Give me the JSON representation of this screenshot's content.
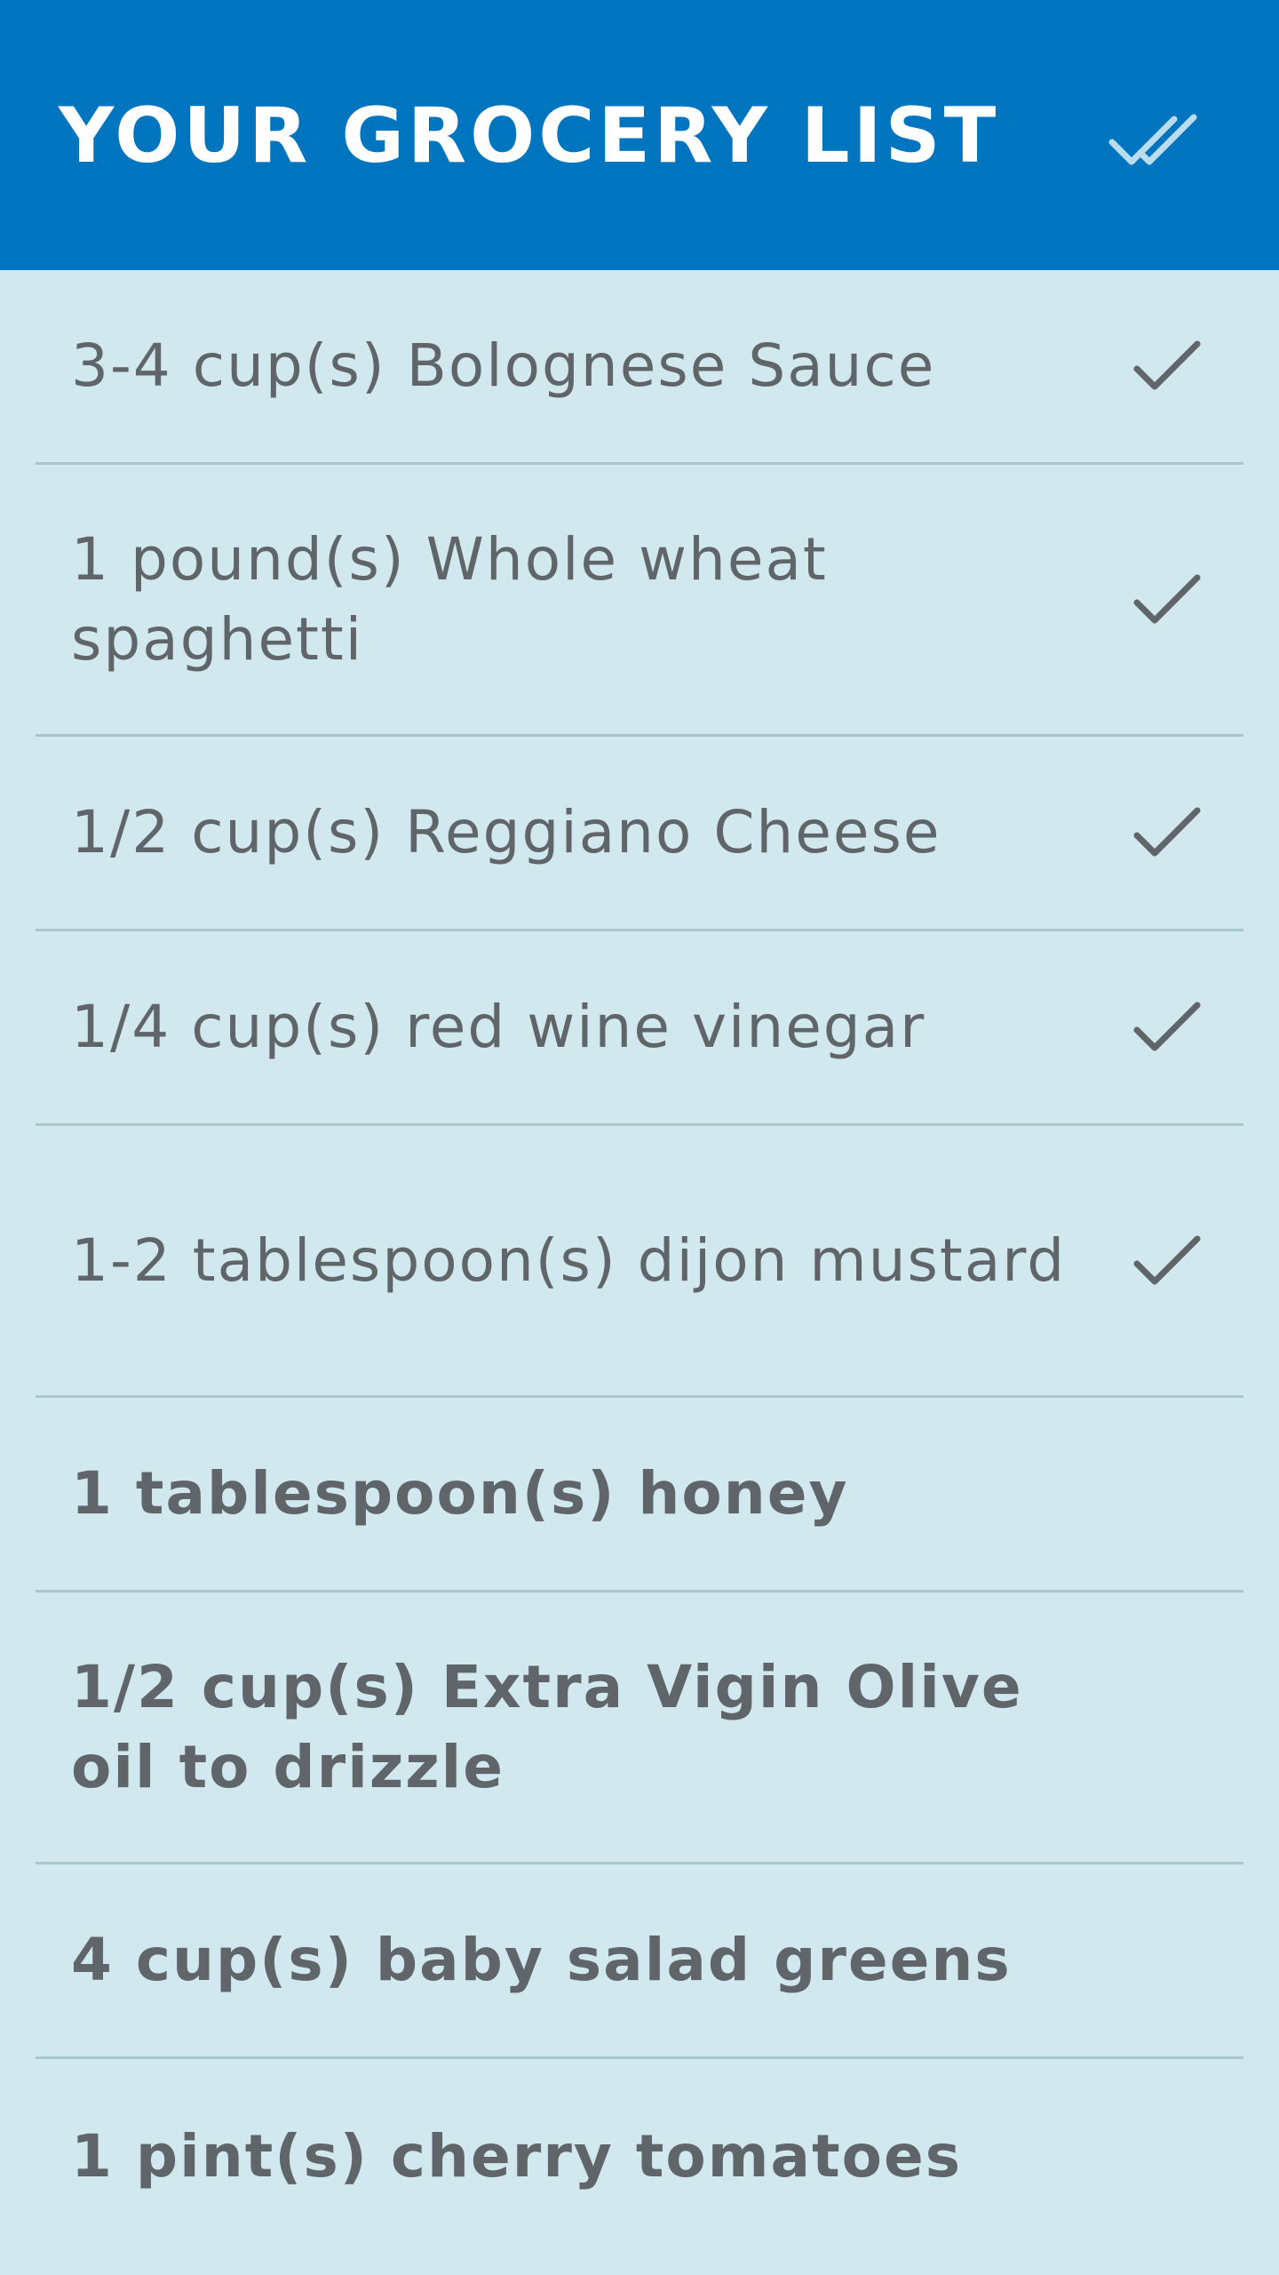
{
  "header": {
    "title": "YOUR GROCERY LIST",
    "check_all_icon": "double-check-icon",
    "background_color": "#0075bf",
    "icon_color": "#b9dcef"
  },
  "colors": {
    "background": "#d1e9ee",
    "text": "#5f6568",
    "divider": "#a9c6cd"
  },
  "items": [
    {
      "label": "3-4 cup(s) Bolognese Sauce",
      "checked": true
    },
    {
      "label": "1 pound(s) Whole wheat spaghetti",
      "checked": true
    },
    {
      "label": "1/2 cup(s) Reggiano Cheese",
      "checked": true
    },
    {
      "label": "1/4 cup(s) red wine vinegar",
      "checked": true
    },
    {
      "label": "1-2 tablespoon(s) dijon mustard",
      "checked": true
    },
    {
      "label": "1 tablespoon(s) honey",
      "checked": false
    },
    {
      "label": "1/2 cup(s) Extra Vigin Olive oil to drizzle",
      "checked": false
    },
    {
      "label": "4 cup(s) baby salad greens",
      "checked": false
    },
    {
      "label": "1 pint(s) cherry tomatoes",
      "checked": false
    }
  ]
}
